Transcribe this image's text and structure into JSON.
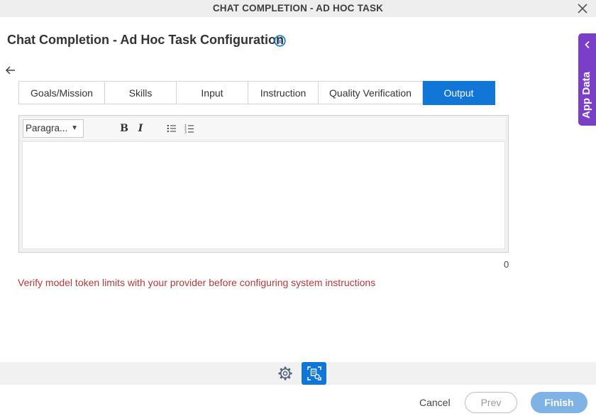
{
  "window": {
    "title": "CHAT COMPLETION - AD HOC TASK"
  },
  "header": {
    "title": "Chat Completion - Ad Hoc Task Configuration"
  },
  "tabs": [
    {
      "label": "Goals/Mission"
    },
    {
      "label": "Skills"
    },
    {
      "label": "Input"
    },
    {
      "label": "Instruction"
    },
    {
      "label": "Quality Verification"
    },
    {
      "label": "Output",
      "active": true
    }
  ],
  "editor": {
    "paragraph_select": "Paragra...",
    "bold_label": "B",
    "italic_label": "I",
    "content": "",
    "char_count": "0"
  },
  "warning": "Verify model token limits with your provider before configuring system instructions",
  "side_panel": {
    "label": "App Data"
  },
  "footer": {
    "cancel_label": "Cancel",
    "prev_label": "Prev",
    "finish_label": "Finish"
  },
  "colors": {
    "accent": "#1176d6",
    "side_panel": "#7a3ec8",
    "warning": "#b33a3a",
    "finish_disabled": "#7fb3e6"
  },
  "icons": [
    "close-icon",
    "info-icon",
    "back-arrow-icon",
    "bullet-list-icon",
    "numbered-list-icon",
    "chevron-left-icon",
    "gear-icon",
    "configuration-icon"
  ]
}
